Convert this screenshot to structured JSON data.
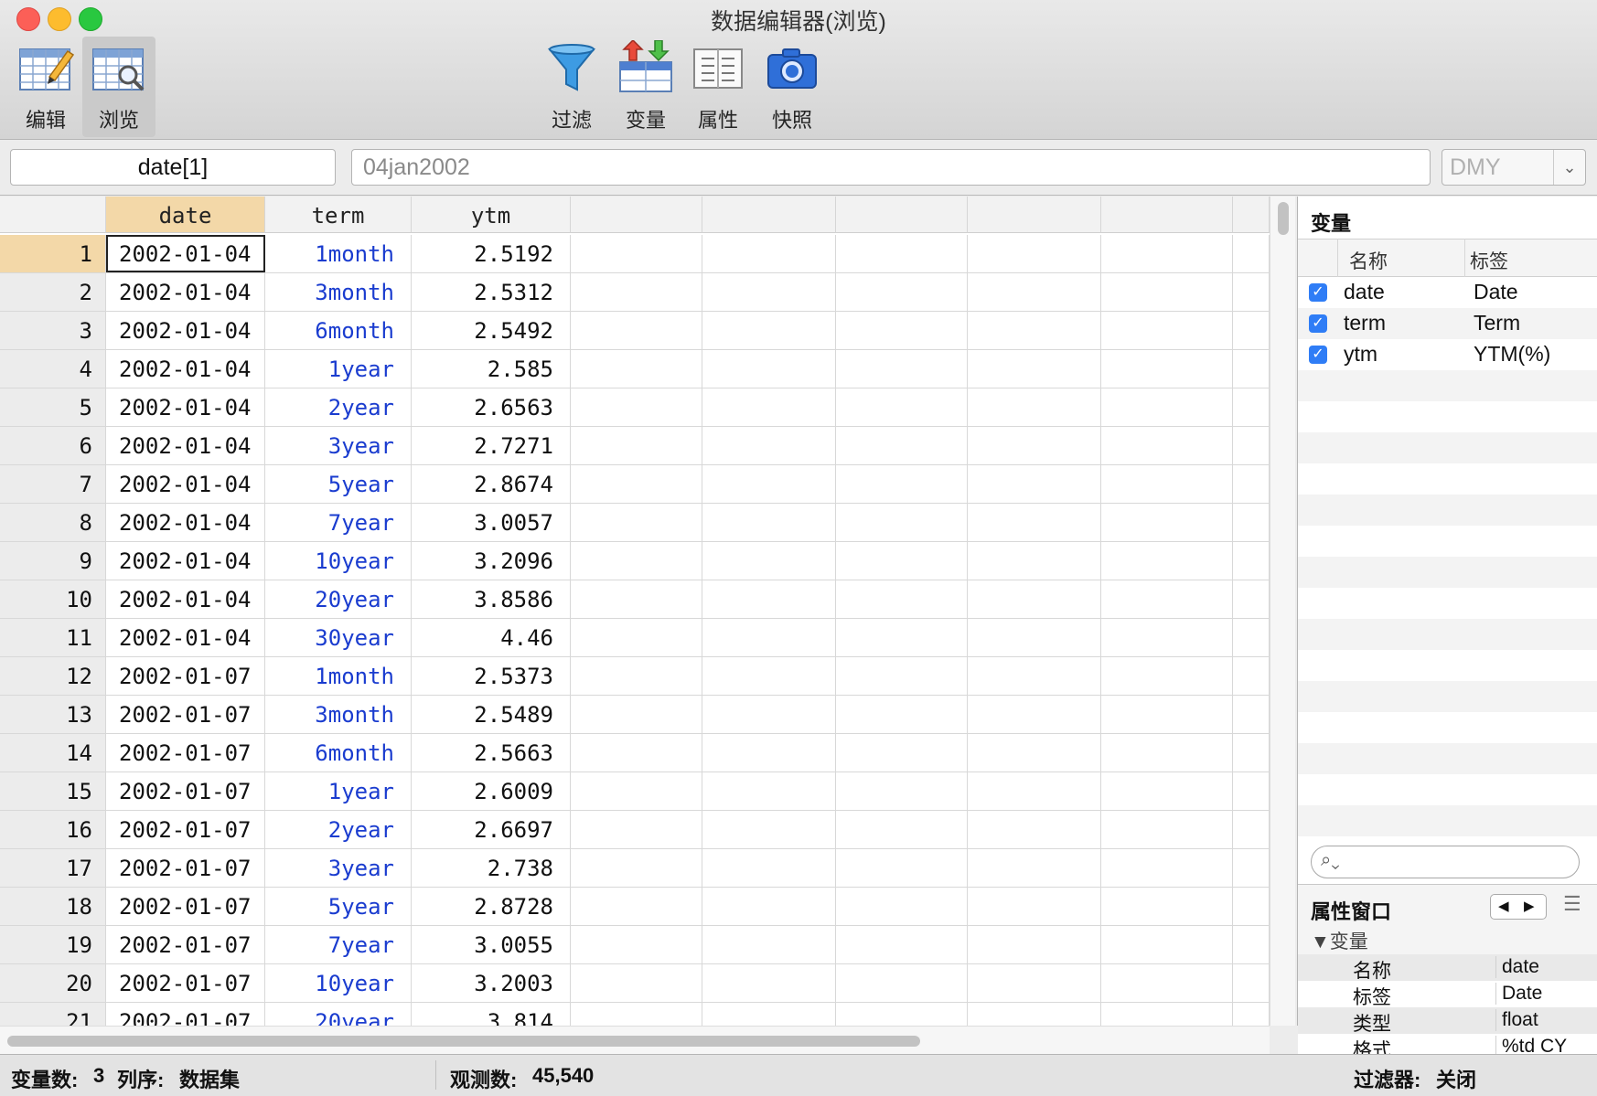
{
  "window": {
    "title": "数据编辑器(浏览)"
  },
  "toolbar": {
    "edit_label": "编辑",
    "browse_label": "浏览",
    "filter_label": "过滤",
    "variables_label": "变量",
    "properties_label": "属性",
    "snapshot_label": "快照"
  },
  "cellbar": {
    "cell_ref": "date[1]",
    "cell_value": "04jan2002",
    "format_value": "DMY"
  },
  "grid": {
    "columns": [
      "date",
      "term",
      "ytm"
    ],
    "rows": [
      {
        "n": "1",
        "date": "2002-01-04",
        "term": "1month",
        "ytm": "2.5192"
      },
      {
        "n": "2",
        "date": "2002-01-04",
        "term": "3month",
        "ytm": "2.5312"
      },
      {
        "n": "3",
        "date": "2002-01-04",
        "term": "6month",
        "ytm": "2.5492"
      },
      {
        "n": "4",
        "date": "2002-01-04",
        "term": "1year",
        "ytm": "2.585"
      },
      {
        "n": "5",
        "date": "2002-01-04",
        "term": "2year",
        "ytm": "2.6563"
      },
      {
        "n": "6",
        "date": "2002-01-04",
        "term": "3year",
        "ytm": "2.7271"
      },
      {
        "n": "7",
        "date": "2002-01-04",
        "term": "5year",
        "ytm": "2.8674"
      },
      {
        "n": "8",
        "date": "2002-01-04",
        "term": "7year",
        "ytm": "3.0057"
      },
      {
        "n": "9",
        "date": "2002-01-04",
        "term": "10year",
        "ytm": "3.2096"
      },
      {
        "n": "10",
        "date": "2002-01-04",
        "term": "20year",
        "ytm": "3.8586"
      },
      {
        "n": "11",
        "date": "2002-01-04",
        "term": "30year",
        "ytm": "4.46"
      },
      {
        "n": "12",
        "date": "2002-01-07",
        "term": "1month",
        "ytm": "2.5373"
      },
      {
        "n": "13",
        "date": "2002-01-07",
        "term": "3month",
        "ytm": "2.5489"
      },
      {
        "n": "14",
        "date": "2002-01-07",
        "term": "6month",
        "ytm": "2.5663"
      },
      {
        "n": "15",
        "date": "2002-01-07",
        "term": "1year",
        "ytm": "2.6009"
      },
      {
        "n": "16",
        "date": "2002-01-07",
        "term": "2year",
        "ytm": "2.6697"
      },
      {
        "n": "17",
        "date": "2002-01-07",
        "term": "3year",
        "ytm": "2.738"
      },
      {
        "n": "18",
        "date": "2002-01-07",
        "term": "5year",
        "ytm": "2.8728"
      },
      {
        "n": "19",
        "date": "2002-01-07",
        "term": "7year",
        "ytm": "3.0055"
      },
      {
        "n": "20",
        "date": "2002-01-07",
        "term": "10year",
        "ytm": "3.2003"
      },
      {
        "n": "21",
        "date": "2002-01-07",
        "term": "20year",
        "ytm": "3.814"
      }
    ]
  },
  "variables_panel": {
    "title": "变量",
    "col_name": "名称",
    "col_label": "标签",
    "items": [
      {
        "name": "date",
        "label": "Date"
      },
      {
        "name": "term",
        "label": "Term"
      },
      {
        "name": "ytm",
        "label": "YTM(%)"
      }
    ]
  },
  "properties_panel": {
    "title": "属性窗口",
    "section": "▼变量",
    "rows": [
      {
        "key": "名称",
        "value": "date"
      },
      {
        "key": "标签",
        "value": "Date"
      },
      {
        "key": "类型",
        "value": "float"
      },
      {
        "key": "格式",
        "value": "%td CY"
      }
    ]
  },
  "status": {
    "vars_label": "变量数:",
    "vars_count": "3",
    "order_label": "列序:",
    "order_value": "数据集",
    "obs_label": "观测数:",
    "obs_count": "45,540",
    "filter_label": "过滤器:",
    "filter_value": "关闭"
  },
  "colors": {
    "accent": "#2f7df6",
    "term_text": "#1a3ccf",
    "selected_header": "#f3d8a8"
  }
}
